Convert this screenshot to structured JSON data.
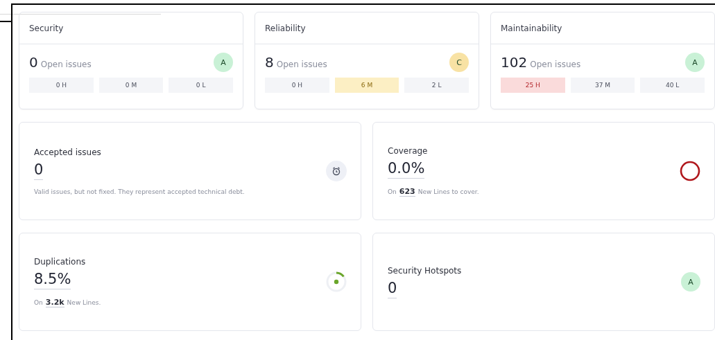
{
  "ratings": [
    {
      "title": "Security",
      "count": "0",
      "count_label": "Open issues",
      "rating": "A",
      "color": "#c9f1d6",
      "severities": [
        {
          "label": "0 H",
          "color": "#f4f5f8"
        },
        {
          "label": "0 M",
          "color": "#f4f5f8"
        },
        {
          "label": "0 L",
          "color": "#f4f5f8"
        }
      ]
    },
    {
      "title": "Reliability",
      "count": "8",
      "count_label": "Open issues",
      "rating": "C",
      "color": "#f8e2a4",
      "severities": [
        {
          "label": "0 H",
          "color": "#f4f5f8"
        },
        {
          "label": "6 M",
          "color": "#fcefc4"
        },
        {
          "label": "2 L",
          "color": "#f4f5f8"
        }
      ]
    },
    {
      "title": "Maintainability",
      "count": "102",
      "count_label": "Open issues",
      "rating": "A",
      "color": "#c9f1d6",
      "severities": [
        {
          "label": "25 H",
          "color": "#fadbdb"
        },
        {
          "label": "37 M",
          "color": "#f4f5f8"
        },
        {
          "label": "40 L",
          "color": "#f4f5f8"
        }
      ]
    }
  ],
  "metrics": [
    {
      "kind": "accepted",
      "title": "Accepted issues",
      "value": "0",
      "note": {
        "text": "Valid issues, but not fixed. They represent accepted technical debt."
      }
    },
    {
      "kind": "coverage",
      "title": "Coverage",
      "value": "0.0%",
      "note": {
        "prefix": "On",
        "link": "623",
        "suffix": "New Lines to cover."
      }
    },
    {
      "kind": "duplications",
      "title": "Duplications",
      "value": "8.5%",
      "note": {
        "prefix": "On",
        "link": "3.2k",
        "suffix": "New Lines."
      }
    },
    {
      "kind": "hotspots",
      "title": "Security Hotspots",
      "value": "0",
      "rating": "A",
      "color": "#c9f1d6"
    }
  ]
}
